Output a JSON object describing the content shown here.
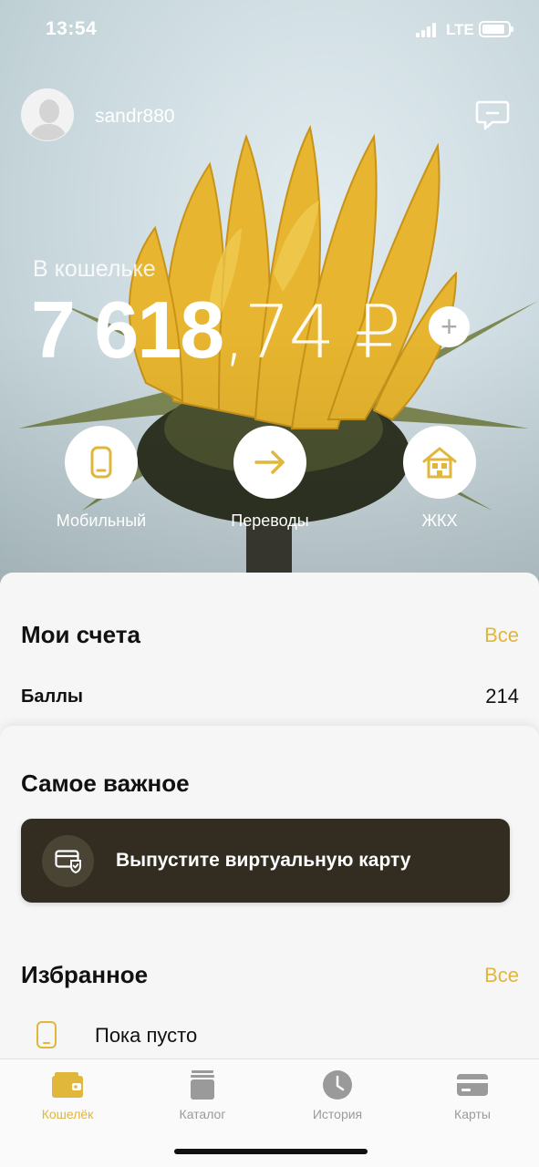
{
  "status_bar": {
    "time": "13:54",
    "network": "LTE"
  },
  "profile": {
    "username": "sandr880"
  },
  "wallet": {
    "label": "В кошельке",
    "balance_integer": "7 618",
    "balance_fraction": ",74 ₽"
  },
  "quick_actions": [
    {
      "label": "Мобильный",
      "icon": "phone-icon"
    },
    {
      "label": "Переводы",
      "icon": "arrow-right-icon"
    },
    {
      "label": "ЖКХ",
      "icon": "house-icon"
    }
  ],
  "accounts": {
    "title": "Мои счета",
    "see_all": "Все",
    "points_label": "Баллы",
    "points_value": "214"
  },
  "important": {
    "title": "Самое важное",
    "banner_text": "Выпустите виртуальную карту"
  },
  "favorites": {
    "title": "Избранное",
    "see_all": "Все",
    "empty_text": "Пока пусто"
  },
  "tabs": [
    {
      "label": "Кошелёк",
      "active": true
    },
    {
      "label": "Каталог",
      "active": false
    },
    {
      "label": "История",
      "active": false
    },
    {
      "label": "Карты",
      "active": false
    }
  ],
  "colors": {
    "accent": "#e0b63b",
    "banner_bg": "#332d21",
    "petal": "#e8b82e"
  }
}
